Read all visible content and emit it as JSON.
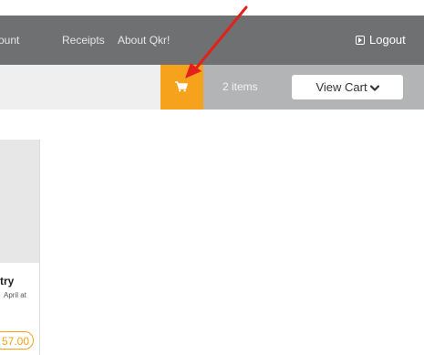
{
  "nav": {
    "items": [
      {
        "label": "ount"
      },
      {
        "label": "Receipts"
      },
      {
        "label": "About Qkr!"
      }
    ],
    "logout_label": "Logout",
    "logout_icon": "logout-icon"
  },
  "cart": {
    "icon": "shopping-cart-icon",
    "count_label": "2 items",
    "view_cart_label": "View Cart",
    "view_cart_icon": "chevron-down-icon"
  },
  "product": {
    "title": "try",
    "subtitle": "April at",
    "price": "57.00"
  },
  "annotation": {
    "icon": "red-arrow-icon"
  },
  "colors": {
    "nav_bg": "#6f7072",
    "accent": "#f7a21c",
    "count_bg": "#b3b4b5",
    "strip_bg": "#efefef",
    "annotation": "#e3201b"
  }
}
